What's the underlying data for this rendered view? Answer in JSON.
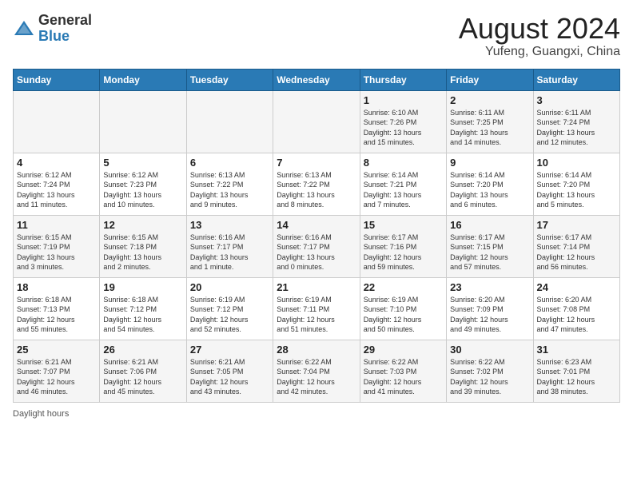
{
  "header": {
    "logo_general": "General",
    "logo_blue": "Blue",
    "month_year": "August 2024",
    "location": "Yufeng, Guangxi, China"
  },
  "days_of_week": [
    "Sunday",
    "Monday",
    "Tuesday",
    "Wednesday",
    "Thursday",
    "Friday",
    "Saturday"
  ],
  "weeks": [
    [
      {
        "day": "",
        "info": ""
      },
      {
        "day": "",
        "info": ""
      },
      {
        "day": "",
        "info": ""
      },
      {
        "day": "",
        "info": ""
      },
      {
        "day": "1",
        "info": "Sunrise: 6:10 AM\nSunset: 7:26 PM\nDaylight: 13 hours\nand 15 minutes."
      },
      {
        "day": "2",
        "info": "Sunrise: 6:11 AM\nSunset: 7:25 PM\nDaylight: 13 hours\nand 14 minutes."
      },
      {
        "day": "3",
        "info": "Sunrise: 6:11 AM\nSunset: 7:24 PM\nDaylight: 13 hours\nand 12 minutes."
      }
    ],
    [
      {
        "day": "4",
        "info": "Sunrise: 6:12 AM\nSunset: 7:24 PM\nDaylight: 13 hours\nand 11 minutes."
      },
      {
        "day": "5",
        "info": "Sunrise: 6:12 AM\nSunset: 7:23 PM\nDaylight: 13 hours\nand 10 minutes."
      },
      {
        "day": "6",
        "info": "Sunrise: 6:13 AM\nSunset: 7:22 PM\nDaylight: 13 hours\nand 9 minutes."
      },
      {
        "day": "7",
        "info": "Sunrise: 6:13 AM\nSunset: 7:22 PM\nDaylight: 13 hours\nand 8 minutes."
      },
      {
        "day": "8",
        "info": "Sunrise: 6:14 AM\nSunset: 7:21 PM\nDaylight: 13 hours\nand 7 minutes."
      },
      {
        "day": "9",
        "info": "Sunrise: 6:14 AM\nSunset: 7:20 PM\nDaylight: 13 hours\nand 6 minutes."
      },
      {
        "day": "10",
        "info": "Sunrise: 6:14 AM\nSunset: 7:20 PM\nDaylight: 13 hours\nand 5 minutes."
      }
    ],
    [
      {
        "day": "11",
        "info": "Sunrise: 6:15 AM\nSunset: 7:19 PM\nDaylight: 13 hours\nand 3 minutes."
      },
      {
        "day": "12",
        "info": "Sunrise: 6:15 AM\nSunset: 7:18 PM\nDaylight: 13 hours\nand 2 minutes."
      },
      {
        "day": "13",
        "info": "Sunrise: 6:16 AM\nSunset: 7:17 PM\nDaylight: 13 hours\nand 1 minute."
      },
      {
        "day": "14",
        "info": "Sunrise: 6:16 AM\nSunset: 7:17 PM\nDaylight: 13 hours\nand 0 minutes."
      },
      {
        "day": "15",
        "info": "Sunrise: 6:17 AM\nSunset: 7:16 PM\nDaylight: 12 hours\nand 59 minutes."
      },
      {
        "day": "16",
        "info": "Sunrise: 6:17 AM\nSunset: 7:15 PM\nDaylight: 12 hours\nand 57 minutes."
      },
      {
        "day": "17",
        "info": "Sunrise: 6:17 AM\nSunset: 7:14 PM\nDaylight: 12 hours\nand 56 minutes."
      }
    ],
    [
      {
        "day": "18",
        "info": "Sunrise: 6:18 AM\nSunset: 7:13 PM\nDaylight: 12 hours\nand 55 minutes."
      },
      {
        "day": "19",
        "info": "Sunrise: 6:18 AM\nSunset: 7:12 PM\nDaylight: 12 hours\nand 54 minutes."
      },
      {
        "day": "20",
        "info": "Sunrise: 6:19 AM\nSunset: 7:12 PM\nDaylight: 12 hours\nand 52 minutes."
      },
      {
        "day": "21",
        "info": "Sunrise: 6:19 AM\nSunset: 7:11 PM\nDaylight: 12 hours\nand 51 minutes."
      },
      {
        "day": "22",
        "info": "Sunrise: 6:19 AM\nSunset: 7:10 PM\nDaylight: 12 hours\nand 50 minutes."
      },
      {
        "day": "23",
        "info": "Sunrise: 6:20 AM\nSunset: 7:09 PM\nDaylight: 12 hours\nand 49 minutes."
      },
      {
        "day": "24",
        "info": "Sunrise: 6:20 AM\nSunset: 7:08 PM\nDaylight: 12 hours\nand 47 minutes."
      }
    ],
    [
      {
        "day": "25",
        "info": "Sunrise: 6:21 AM\nSunset: 7:07 PM\nDaylight: 12 hours\nand 46 minutes."
      },
      {
        "day": "26",
        "info": "Sunrise: 6:21 AM\nSunset: 7:06 PM\nDaylight: 12 hours\nand 45 minutes."
      },
      {
        "day": "27",
        "info": "Sunrise: 6:21 AM\nSunset: 7:05 PM\nDaylight: 12 hours\nand 43 minutes."
      },
      {
        "day": "28",
        "info": "Sunrise: 6:22 AM\nSunset: 7:04 PM\nDaylight: 12 hours\nand 42 minutes."
      },
      {
        "day": "29",
        "info": "Sunrise: 6:22 AM\nSunset: 7:03 PM\nDaylight: 12 hours\nand 41 minutes."
      },
      {
        "day": "30",
        "info": "Sunrise: 6:22 AM\nSunset: 7:02 PM\nDaylight: 12 hours\nand 39 minutes."
      },
      {
        "day": "31",
        "info": "Sunrise: 6:23 AM\nSunset: 7:01 PM\nDaylight: 12 hours\nand 38 minutes."
      }
    ]
  ],
  "footer": {
    "daylight_label": "Daylight hours"
  }
}
